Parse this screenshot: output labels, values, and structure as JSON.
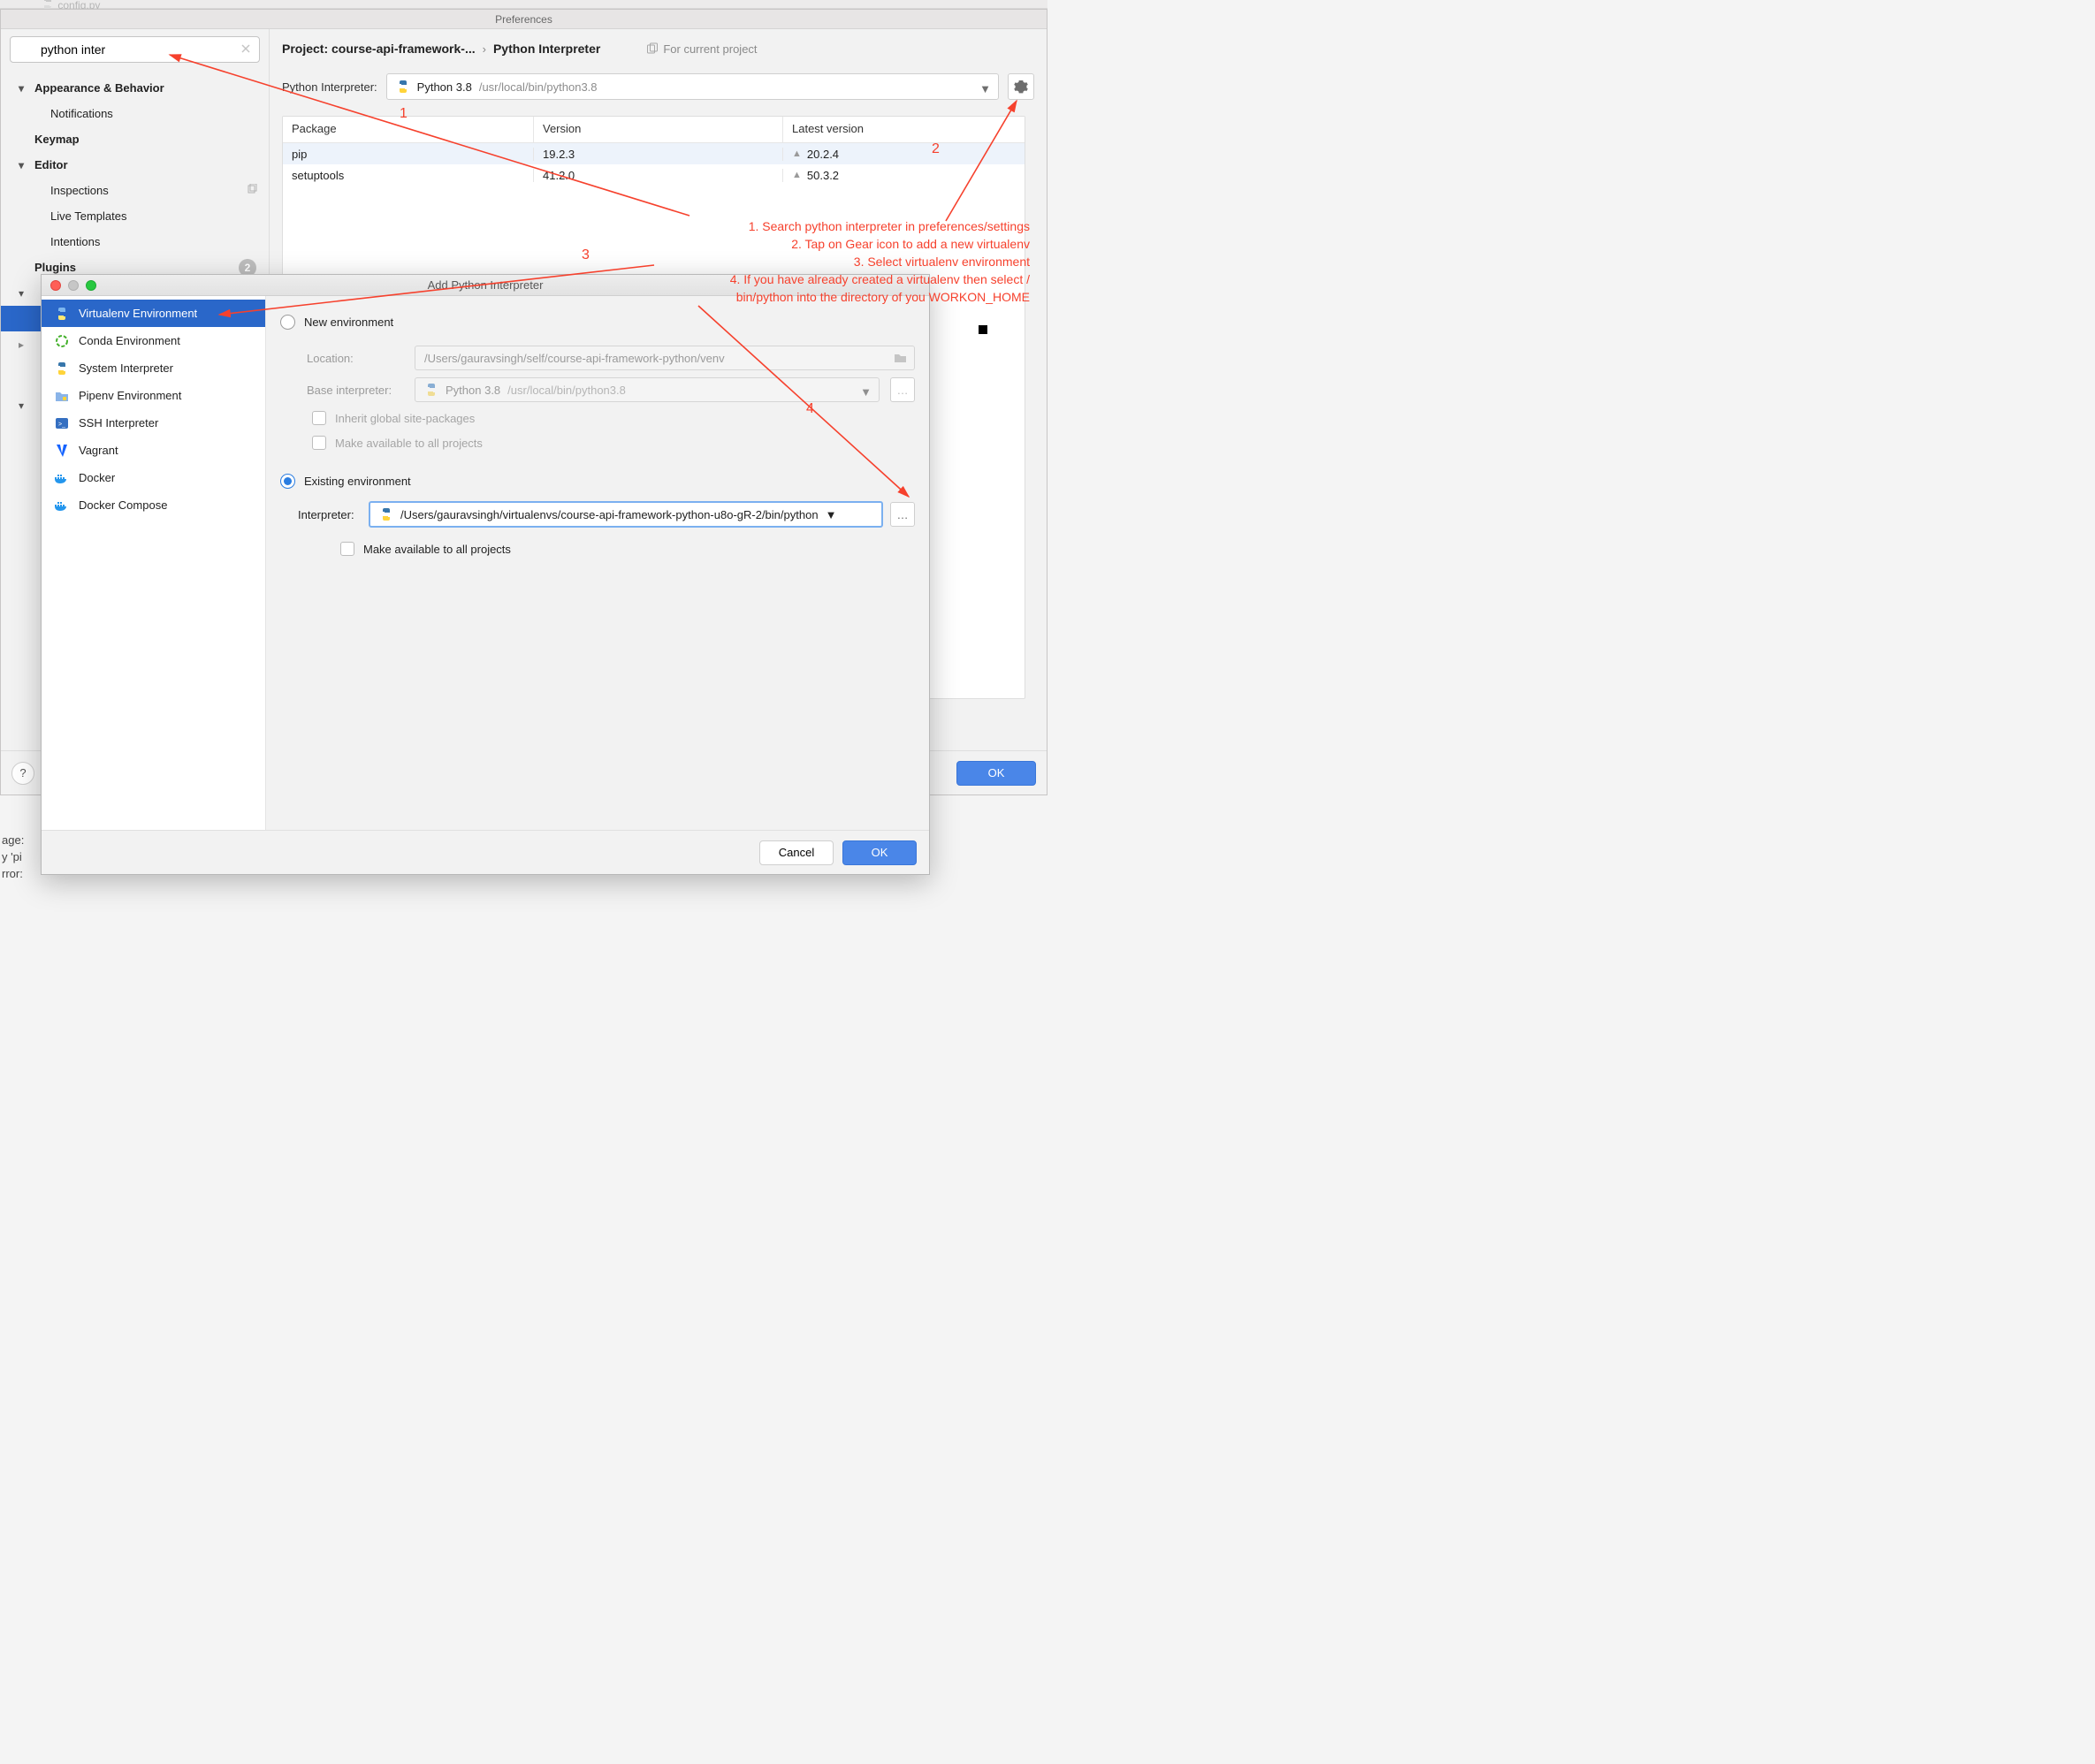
{
  "faded_file": "config.py",
  "pref": {
    "title": "Preferences",
    "search_value": "python inter",
    "sidebar": {
      "appearance": "Appearance & Behavior",
      "notifications": "Notifications",
      "keymap": "Keymap",
      "editor": "Editor",
      "inspections": "Inspections",
      "live_templates": "Live Templates",
      "intentions": "Intentions",
      "plugins": "Plugins",
      "plugins_count": "2"
    },
    "breadcrumb": {
      "project": "Project: course-api-framework-...",
      "page": "Python Interpreter",
      "for_project": "For current project"
    },
    "interpreter_label": "Python Interpreter:",
    "interpreter_value_main": "Python 3.8",
    "interpreter_value_path": "/usr/local/bin/python3.8",
    "packages": {
      "cols": [
        "Package",
        "Version",
        "Latest version"
      ],
      "rows": [
        {
          "name": "pip",
          "version": "19.2.3",
          "latest": "20.2.4"
        },
        {
          "name": "setuptools",
          "version": "41.2.0",
          "latest": "50.3.2"
        }
      ]
    },
    "ok_button": "OK"
  },
  "modal": {
    "title": "Add Python Interpreter",
    "side": [
      "Virtualenv Environment",
      "Conda Environment",
      "System Interpreter",
      "Pipenv Environment",
      "SSH Interpreter",
      "Vagrant",
      "Docker",
      "Docker Compose"
    ],
    "new_env_label": "New environment",
    "location_label": "Location:",
    "location_value": "/Users/gauravsingh/self/course-api-framework-python/venv",
    "base_label": "Base interpreter:",
    "base_main": "Python 3.8",
    "base_path": "/usr/local/bin/python3.8",
    "chk_inherit": "Inherit global site-packages",
    "chk_avail1": "Make available to all projects",
    "existing_label": "Existing environment",
    "interp_label": "Interpreter:",
    "interp_value": "/Users/gauravsingh/virtualenvs/course-api-framework-python-u8o-gR-2/bin/python",
    "chk_avail2": "Make available to all projects",
    "cancel": "Cancel",
    "ok": "OK"
  },
  "annotations": {
    "n1": "1",
    "n2": "2",
    "n3": "3",
    "n4": "4",
    "lines": [
      "1. Search python interpreter in preferences/settings",
      "2. Tap on Gear icon to add a new virtualenv",
      "3. Select virtualenv environment",
      "4. If you have already created a virtualenv then select /",
      "bin/python into the directory of you WORKON_HOME"
    ]
  },
  "console": {
    "l1": "age:",
    "l2": "y 'pi",
    "l3": "",
    "l4": "rror:"
  }
}
